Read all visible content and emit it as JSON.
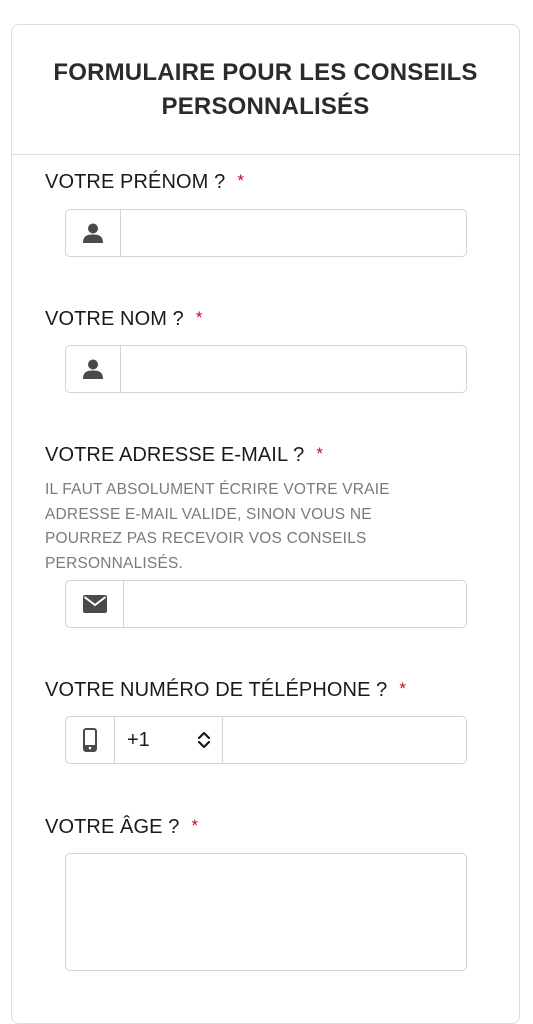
{
  "form": {
    "title": "FORMULAIRE POUR LES CONSEILS PERSONNALISÉS",
    "required_mark": "*",
    "first_name": {
      "label": "VOTRE PRÉNOM ?",
      "icon": "user-icon",
      "value": ""
    },
    "last_name": {
      "label": "VOTRE NOM ?",
      "icon": "user-icon",
      "value": ""
    },
    "email": {
      "label": "VOTRE ADRESSE E-MAIL ?",
      "help": "IL FAUT ABSOLUMENT ÉCRIRE VOTRE VRAIE ADRESSE E-MAIL VALIDE, SINON VOUS NE POURREZ PAS RECEVOIR VOS CONSEILS PERSONNALISÉS.",
      "icon": "envelope-icon",
      "value": ""
    },
    "phone": {
      "label": "VOTRE NUMÉRO DE TÉLÉPHONE ?",
      "icon": "mobile-phone-icon",
      "country_code": "+1",
      "value": ""
    },
    "age": {
      "label": "VOTRE ÂGE ?",
      "value": ""
    }
  },
  "colors": {
    "required": "#d0021b",
    "border": "#d4d4d4",
    "icon": "#4a4a4a",
    "help_text": "#7a7a7a"
  }
}
